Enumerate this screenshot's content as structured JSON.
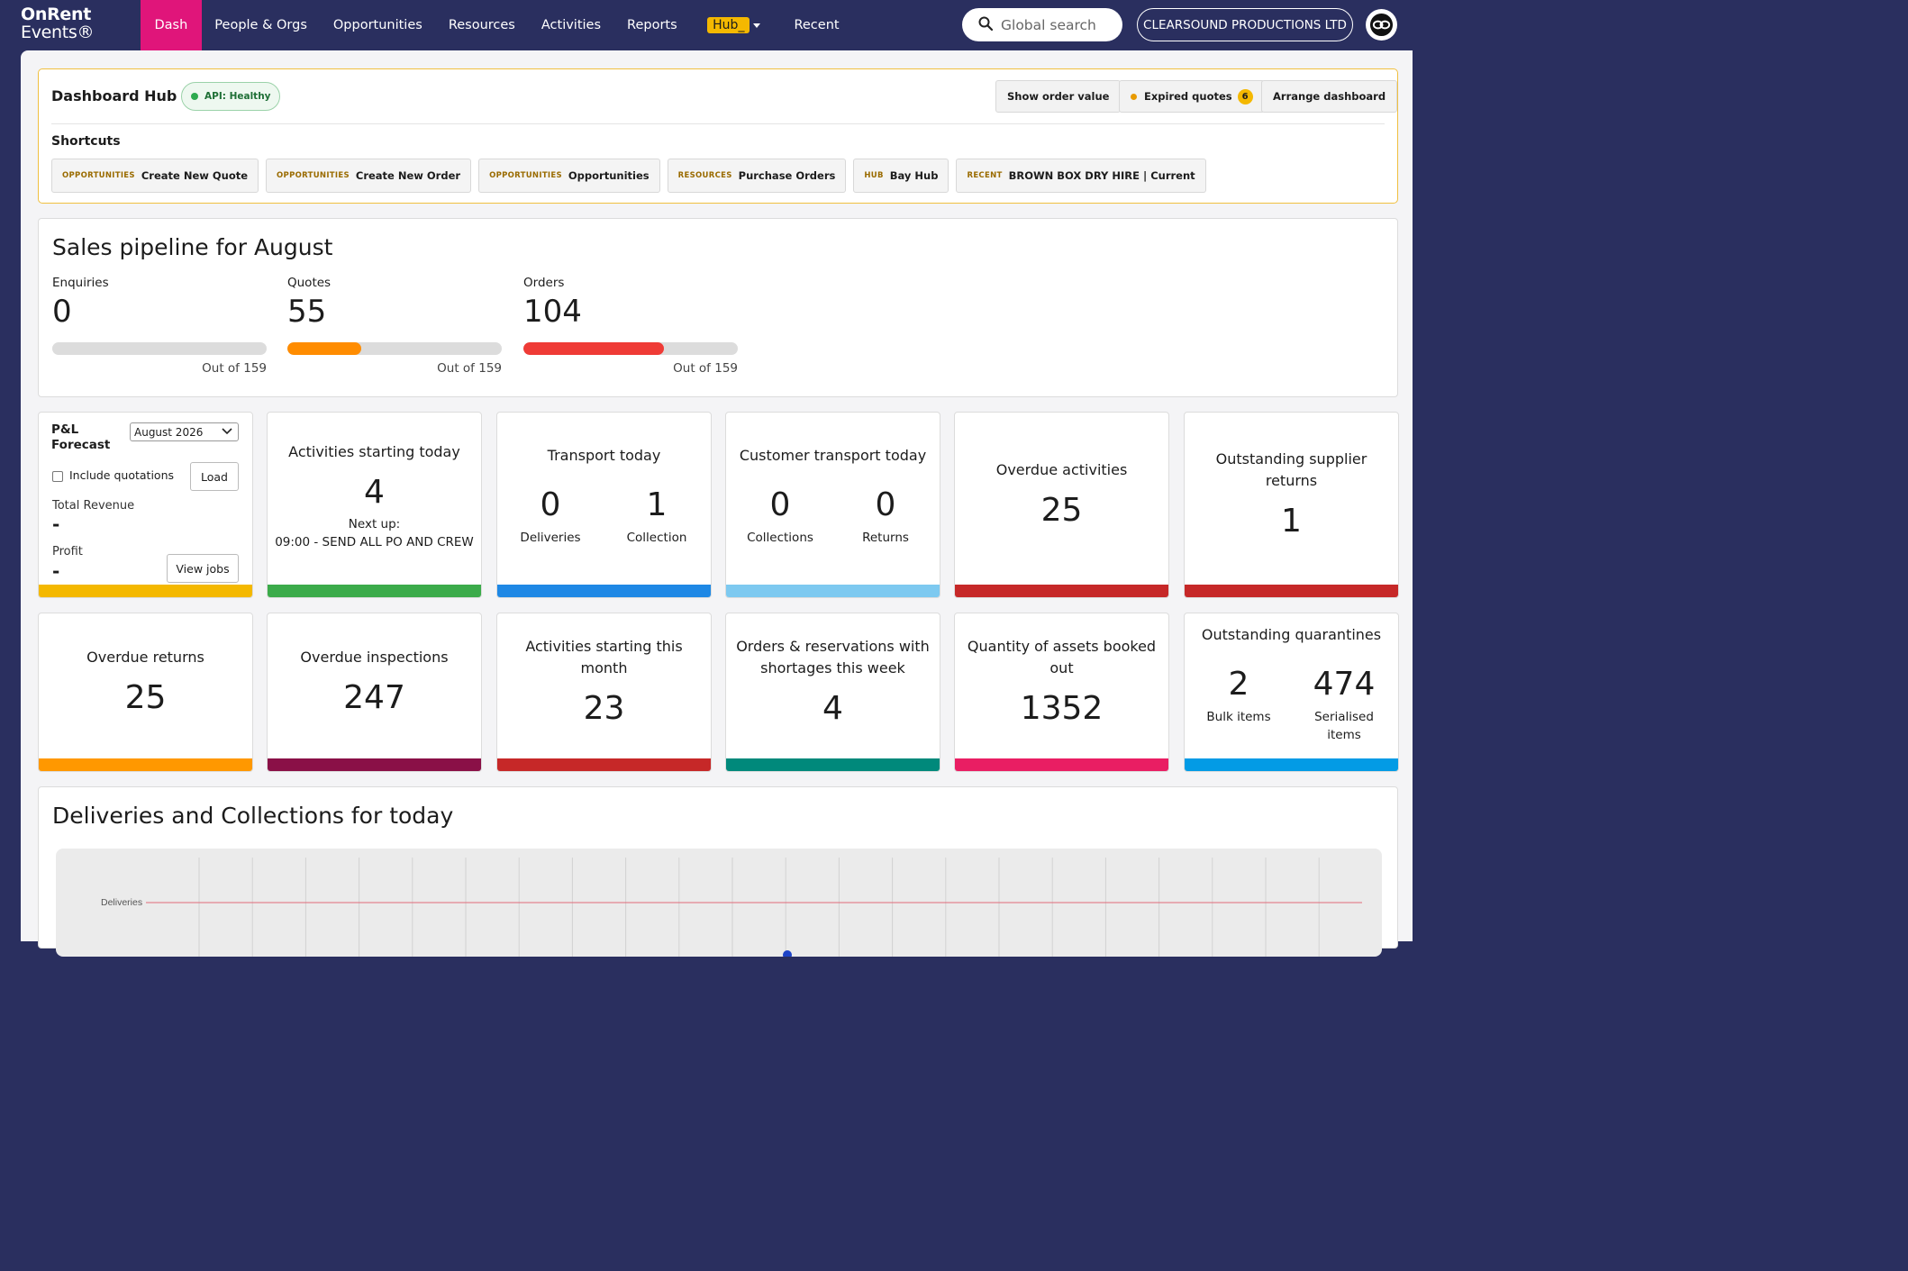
{
  "brand": {
    "line1": "OnRent",
    "line2": "Events®"
  },
  "nav": {
    "items": [
      "Dash",
      "People & Orgs",
      "Opportunities",
      "Resources",
      "Activities",
      "Reports"
    ],
    "hub_label": "Hub_",
    "recent_label": "Recent"
  },
  "search": {
    "placeholder": "Global search"
  },
  "company": "CLEARSOUND PRODUCTIONS LTD",
  "hub": {
    "title": "Dashboard Hub",
    "api_status": "API: Healthy",
    "show_order_value": "Show order value",
    "expired_quotes": "Expired quotes",
    "expired_quotes_count": "6",
    "arrange_dashboard": "Arrange dashboard",
    "shortcuts_label": "Shortcuts",
    "shortcuts": [
      {
        "cat": "OPPORTUNITIES",
        "label": "Create New Quote"
      },
      {
        "cat": "OPPORTUNITIES",
        "label": "Create New Order"
      },
      {
        "cat": "OPPORTUNITIES",
        "label": "Opportunities"
      },
      {
        "cat": "RESOURCES",
        "label": "Purchase Orders"
      },
      {
        "cat": "HUB",
        "label": "Bay Hub"
      },
      {
        "cat": "RECENT",
        "label": "BROWN BOX DRY HIRE | Current"
      }
    ]
  },
  "pipeline": {
    "title": "Sales pipeline for August",
    "items": [
      {
        "label": "Enquiries",
        "value": "0",
        "total": "Out of 159",
        "fraction": 0,
        "color": "#dcdcdc"
      },
      {
        "label": "Quotes",
        "value": "55",
        "total": "Out of 159",
        "fraction": 0.346,
        "color": "#ff8c00"
      },
      {
        "label": "Orders",
        "value": "104",
        "total": "Out of 159",
        "fraction": 0.654,
        "color": "#ef3b36"
      }
    ]
  },
  "pl": {
    "title_line1": "P&L",
    "title_line2": "Forecast",
    "period": "August 2026",
    "include_quotations": "Include quotations",
    "load": "Load",
    "total_revenue_label": "Total Revenue",
    "total_revenue": "-",
    "profit_label": "Profit",
    "profit": "-",
    "view_jobs": "View jobs"
  },
  "tiles": {
    "activities_today": {
      "title": "Activities starting today",
      "value": "4",
      "next_label": "Next up:",
      "next_item": "09:00 - SEND ALL PO AND CREW"
    },
    "transport_today": {
      "title": "Transport today",
      "a_value": "0",
      "a_label": "Deliveries",
      "b_value": "1",
      "b_label": "Collection"
    },
    "customer_transport": {
      "title": "Customer transport today",
      "a_value": "0",
      "a_label": "Collections",
      "b_value": "0",
      "b_label": "Returns"
    },
    "overdue_activities": {
      "title": "Overdue activities",
      "value": "25"
    },
    "supplier_returns": {
      "title": "Outstanding supplier returns",
      "value": "1"
    },
    "overdue_returns": {
      "title": "Overdue returns",
      "value": "25"
    },
    "overdue_inspections": {
      "title": "Overdue inspections",
      "value": "247"
    },
    "activities_month": {
      "title": "Activities starting this month",
      "value": "23"
    },
    "shortages": {
      "title": "Orders & reservations with shortages this week",
      "value": "4"
    },
    "assets_booked": {
      "title": "Quantity of assets booked out",
      "value": "1352"
    },
    "quarantines": {
      "title": "Outstanding quarantines",
      "a_value": "2",
      "a_label": "Bulk items",
      "b_value": "474",
      "b_label": "Serialised items"
    }
  },
  "colors": {
    "nav_bg": "#2a2f5f",
    "active_tab": "#e0157a",
    "strip_pl": "#f4b800",
    "strip_activities": "#3bab4a",
    "strip_transport": "#1e88e5",
    "strip_customer": "#7dc9f0",
    "strip_overdue": "#c62828",
    "strip_supplier": "#c62828",
    "strip_returns": "#ff9800",
    "strip_inspections": "#8a1047",
    "strip_month": "#c62828",
    "strip_shortages": "#00897b",
    "strip_assets": "#e91e63",
    "strip_quarantine": "#039be5"
  },
  "deliveries": {
    "title": "Deliveries and Collections for today",
    "row_label": "Deliveries"
  }
}
